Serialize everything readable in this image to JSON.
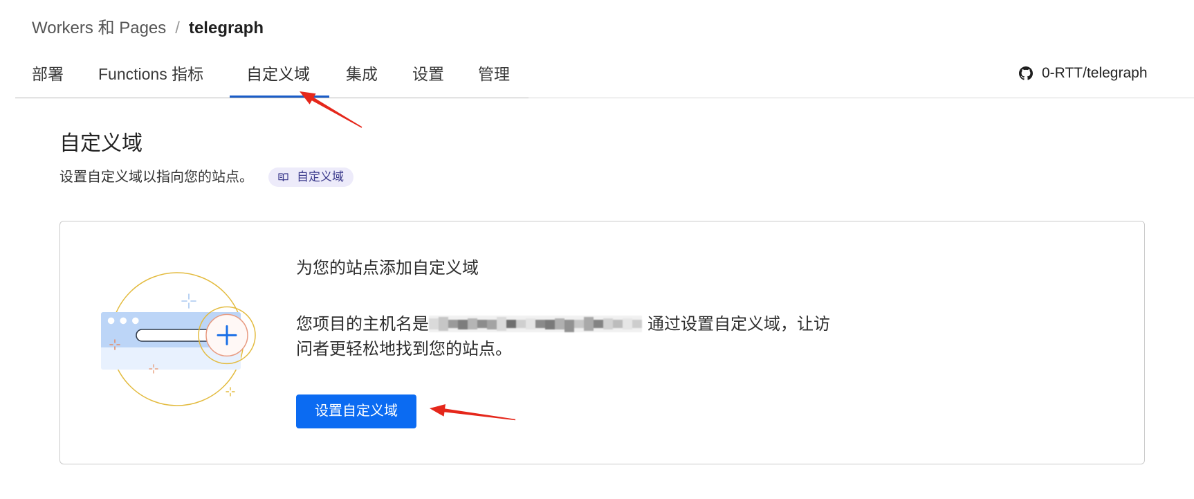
{
  "breadcrumb": {
    "parent": "Workers 和 Pages",
    "separator": "/",
    "current": "telegraph"
  },
  "tabs": [
    {
      "label": "部署",
      "active": false
    },
    {
      "label": "Functions 指标",
      "active": false
    },
    {
      "label": "自定义域",
      "active": true
    },
    {
      "label": "集成",
      "active": false
    },
    {
      "label": "设置",
      "active": false
    },
    {
      "label": "管理",
      "active": false
    }
  ],
  "repo": {
    "icon": "github-icon",
    "label": "0-RTT/telegraph"
  },
  "section": {
    "title": "自定义域",
    "description": "设置自定义域以指向您的站点。",
    "doc_badge": {
      "icon": "book-icon",
      "label": "自定义域"
    }
  },
  "empty_state": {
    "illustration": "browser-add-domain-illustration",
    "title": "为您的站点添加自定义域",
    "body_prefix": "您项目的主机名是",
    "body_line1_suffix": "通过设置自定义域，让访",
    "body_line2": "问者更轻松地找到您的站点。",
    "primary_button": "设置自定义域"
  },
  "colors": {
    "primary": "#0b6bf2",
    "active_tab_underline": "#1a5dc9",
    "badge_background": "#edebfa",
    "badge_text": "#3b3a8c",
    "illustration_ring": "#e3bb3f",
    "annotation_arrow": "#e5271b"
  }
}
